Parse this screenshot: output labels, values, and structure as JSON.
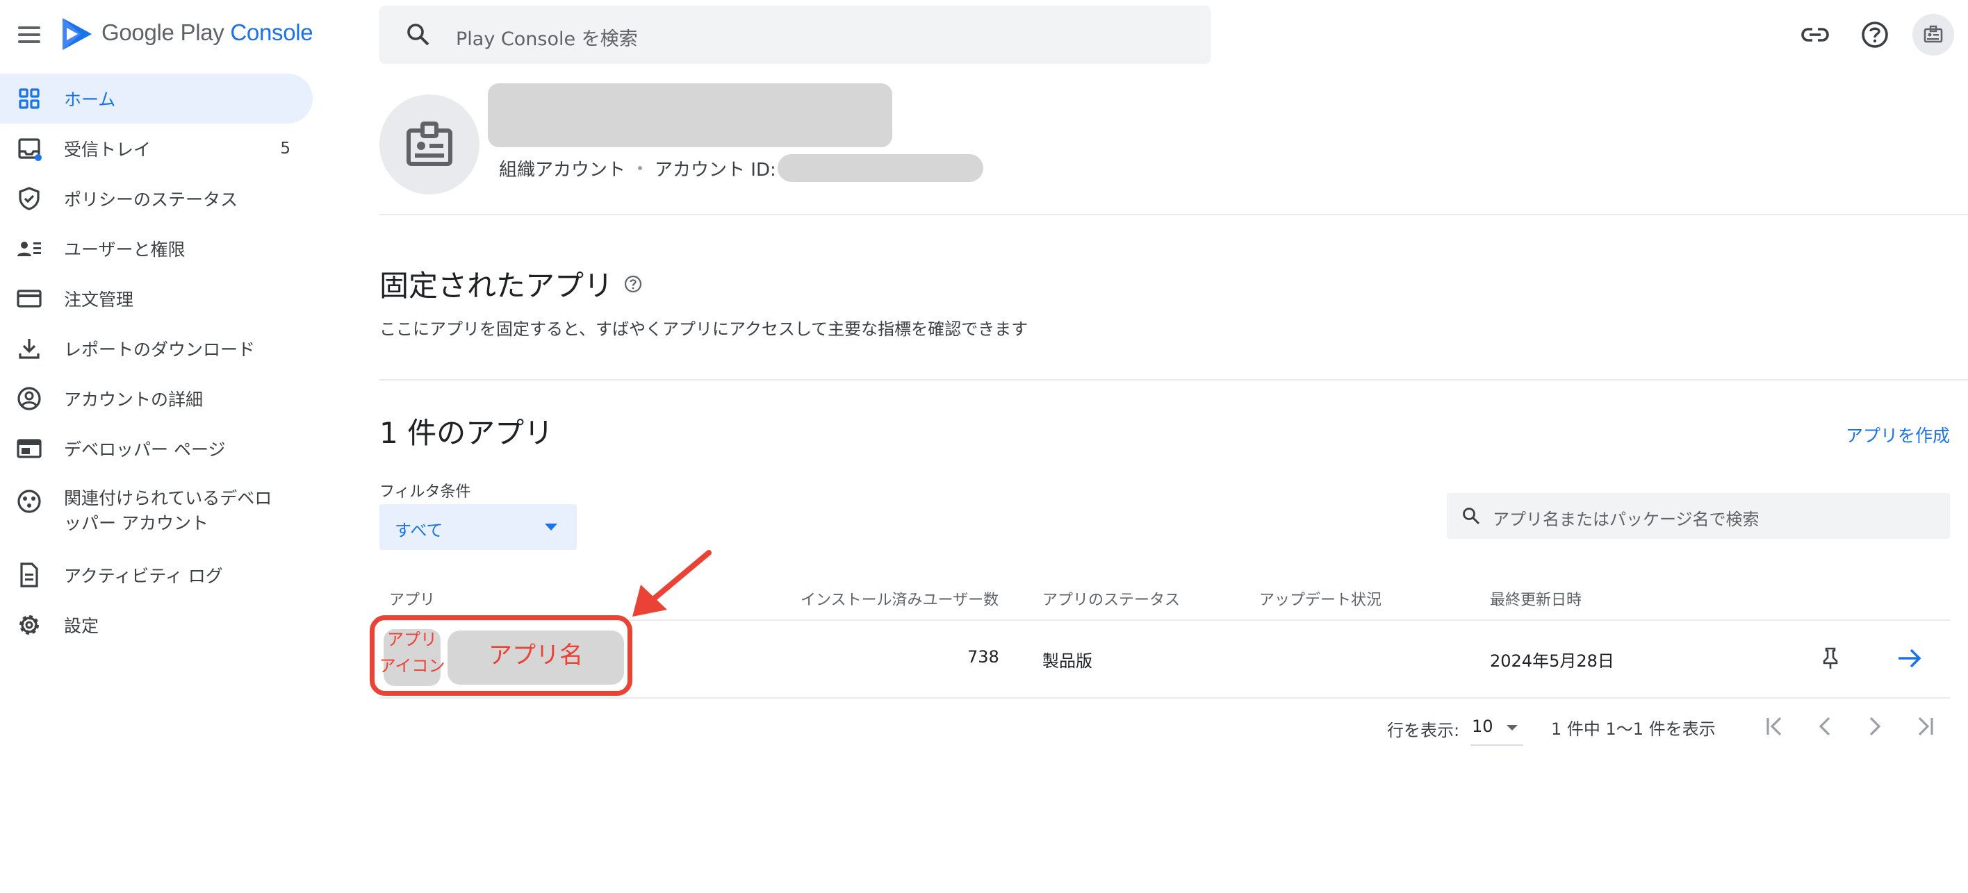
{
  "brand": {
    "name_prefix": "Google Play",
    "name_accent": "Console"
  },
  "search": {
    "placeholder": "Play Console を検索"
  },
  "sidebar": {
    "items": [
      {
        "label": "ホーム",
        "icon": "dashboard-icon",
        "active": true
      },
      {
        "label": "受信トレイ",
        "icon": "inbox-icon",
        "count": "5"
      },
      {
        "label": "ポリシーのステータス",
        "icon": "shield-icon"
      },
      {
        "label": "ユーザーと権限",
        "icon": "users-icon"
      },
      {
        "label": "注文管理",
        "icon": "credit-card-icon"
      },
      {
        "label": "レポートのダウンロード",
        "icon": "download-icon"
      },
      {
        "label": "アカウントの詳細",
        "icon": "account-circle-icon"
      },
      {
        "label": "デベロッパー ページ",
        "icon": "web-page-icon"
      },
      {
        "label": "関連付けられているデベロッパー アカウント",
        "label_line1": "関連付けられているデベロ",
        "label_line2": "ッパー アカウント",
        "icon": "linked-accounts-icon"
      },
      {
        "label": "アクティビティ ログ",
        "icon": "document-icon"
      },
      {
        "label": "設定",
        "icon": "gear-icon"
      }
    ]
  },
  "account": {
    "type": "組織アカウント",
    "id_label": "アカウント ID:"
  },
  "pinned": {
    "title": "固定されたアプリ",
    "description": "ここにアプリを固定すると、すばやくアプリにアクセスして主要な指標を確認できます"
  },
  "apps": {
    "title": "1 件のアプリ",
    "create_link": "アプリを作成",
    "filter_label": "フィルタ条件",
    "filter_value": "すべて",
    "search_placeholder": "アプリ名またはパッケージ名で検索",
    "columns": [
      "アプリ",
      "インストール済みユーザー数",
      "アプリのステータス",
      "アップデート状況",
      "最終更新日時"
    ],
    "rows": [
      {
        "icon_placeholder_line1": "アプリ",
        "icon_placeholder_line2": "アイコン",
        "name_placeholder": "アプリ名",
        "installs": "738",
        "status": "製品版",
        "update_status": "",
        "last_updated": "2024年5月28日"
      }
    ]
  },
  "pagination": {
    "rows_label": "行を表示:",
    "rows_value": "10",
    "range_text": "1 件中 1〜1 件を表示"
  },
  "colors": {
    "accent": "#1a73e8",
    "active_bg": "#e8f0fe",
    "annotation": "#ea4335"
  }
}
